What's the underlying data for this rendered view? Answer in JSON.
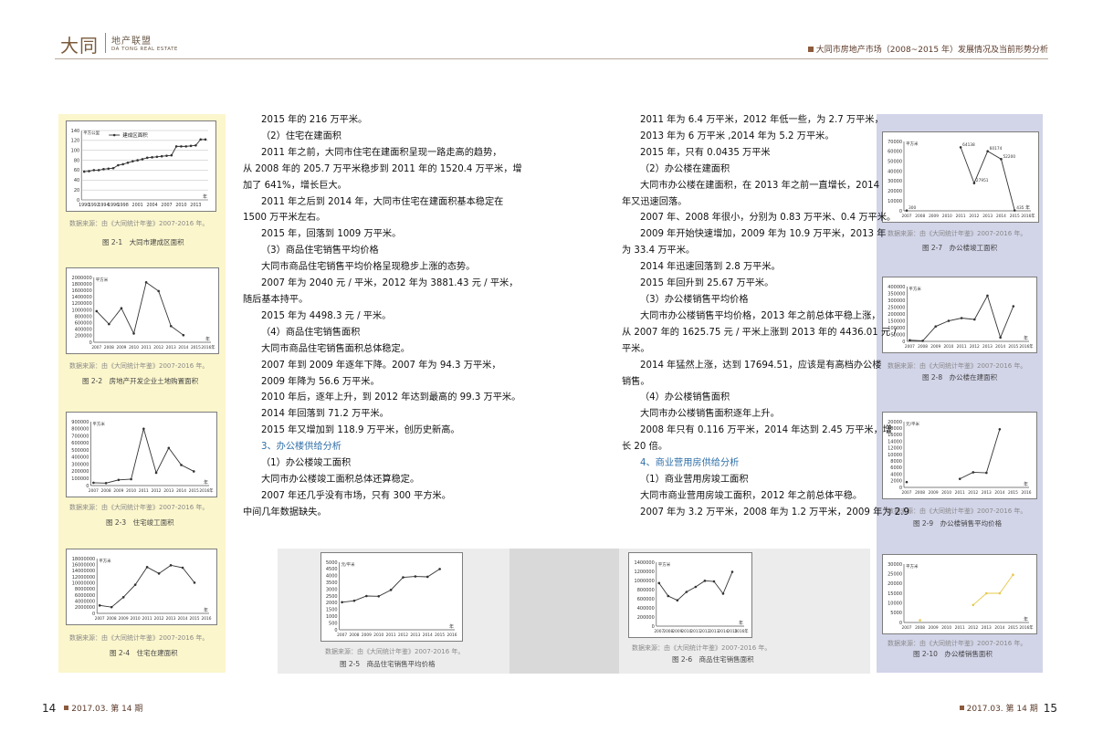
{
  "header": {
    "logo_mark": "大同",
    "logo_cn": "地产联盟",
    "logo_en": "DA TONG REAL ESTATE",
    "title": "大同市房地产市场（2008~2015 年）发展情况及当前形势分析"
  },
  "left_page": {
    "column1": [
      "2015 年的 216 万平米。",
      "（2）住宅在建面积",
      "2011 年之前，大同市住宅在建面积呈现一路走高的趋势，",
      "从 2008 年的 205.7 万平米稳步到 2011 年的 1520.4 万平米，增",
      "加了 641%，增长巨大。",
      "2011 年之后到 2014 年，大同市住宅在建面积基本稳定在",
      "1500 万平米左右。",
      "2015 年，回落到 1009 万平米。",
      "（3）商品住宅销售平均价格",
      "大同市商品住宅销售平均价格呈现稳步上涨的态势。",
      "2007 年为 2040 元 / 平米，2012 年为 3881.43 元 / 平米，",
      "随后基本持平。",
      "2015 年为 4498.3 元 / 平米。",
      "（4）商品住宅销售面积",
      "大同市商品住宅销售面积总体稳定。",
      "2007 年到 2009 年逐年下降。2007 年为 94.3 万平米，",
      "2009 年降为 56.6 万平米。",
      "2010 年后，逐年上升，到 2012 年达到最高的 99.3 万平米。",
      "2014 年回落到 71.2 万平米。",
      "2015 年又增加到 118.9 万平米，创历史新高。",
      "3、办公楼供给分析",
      "（1）办公楼竣工面积",
      "大同市办公楼竣工面积总体还算稳定。",
      "2007 年还几乎没有市场，只有 300 平方米。",
      "中间几年数据缺失。"
    ],
    "footer_page": "14",
    "footer_issue": "2017.03. 第 14 期"
  },
  "right_page": {
    "column2": [
      "2011 年为 6.4 万平米，2012 年低一些，为 2.7 万平米，",
      "2013 年为 6 万平米 ,2014 年为 5.2 万平米。",
      "2015 年，只有 0.0435 万平米",
      "（2）办公楼在建面积",
      "大同市办公楼在建面积，在 2013 年之前一直增长，2014",
      "年又迅速回落。",
      "2007 年、2008 年很小，分别为 0.83 万平米、0.4 万平米。",
      "2009 年开始快速增加，2009 年为 10.9 万平米，2013 年",
      "为 33.4 万平米。",
      "2014 年迅速回落到 2.8 万平米。",
      "2015 年回升到 25.67 万平米。",
      "（3）办公楼销售平均价格",
      "大同市办公楼销售平均价格，2013 年之前总体平稳上涨，",
      "从 2007 年的 1625.75 元 / 平米上涨到 2013 年的 4436.01 元 /",
      "平米。",
      "2014 年猛然上涨，达到 17694.51，应该是有高档办公楼",
      "销售。",
      "（4）办公楼销售面积",
      "大同市办公楼销售面积逐年上升。",
      "2008 年只有 0.116 万平米，2014 年达到 2.45 万平米，增",
      "长 20 倍。",
      "4、商业营用房供给分析",
      "（1）商业营用房竣工面积",
      "大同市商业营用房竣工面积，2012 年之前总体平稳。",
      "2007 年为 3.2 万平米，2008 年为 1.2 万平米，2009 年为 2.9"
    ],
    "footer_page": "15",
    "footer_issue": "2017.03. 第 14 期"
  },
  "figures": {
    "source_text": "数据来源：由《大同统计年鉴》2007-2016 年。",
    "fig1": {
      "caption": "图 2-1　大同市建成区面积",
      "legend": "建成区面积"
    },
    "fig2": {
      "caption": "图 2-2　房地产开发企业土地购置面积"
    },
    "fig3": {
      "caption": "图 2-3　住宅竣工面积"
    },
    "fig4": {
      "caption": "图 2-4　住宅在建面积"
    },
    "fig5": {
      "caption": "图 2-5　商品住宅销售平均价格"
    },
    "fig6": {
      "caption": "图 2-6　商品住宅销售面积"
    },
    "fig7": {
      "caption": "图 2-7　办公楼竣工面积"
    },
    "fig8": {
      "caption": "图 2-8　办公楼在建面积"
    },
    "fig9": {
      "caption": "图 2-9　办公楼销售平均价格"
    },
    "fig10": {
      "caption": "图 2-10　办公楼销售面积"
    }
  },
  "chart_data": [
    {
      "id": "fig1",
      "type": "line",
      "title": "",
      "legend": [
        "建成区面积"
      ],
      "ylabel": "平方公里",
      "xlabel": "年",
      "x": [
        1990,
        1991,
        1992,
        1993,
        1994,
        1995,
        1996,
        1997,
        1998,
        1999,
        2000,
        2001,
        2002,
        2003,
        2004,
        2005,
        2006,
        2007,
        2008,
        2009,
        2010,
        2011,
        2012,
        2013,
        2014,
        2015
      ],
      "values": [
        57,
        58,
        60,
        60,
        62,
        63,
        64,
        70,
        72,
        75,
        78,
        80,
        82,
        85,
        86,
        87,
        88,
        89,
        90,
        108,
        108,
        108,
        109,
        110,
        122,
        122
      ],
      "ylim": [
        0,
        140
      ],
      "yticks": [
        0,
        20,
        40,
        60,
        80,
        100,
        120,
        140
      ],
      "xticks": [
        "1990",
        "1992",
        "1994",
        "1996",
        "1998",
        "2001",
        "2004",
        "2007",
        "2010",
        "2013"
      ],
      "color": "#333333",
      "grid": true
    },
    {
      "id": "fig2",
      "type": "line",
      "ylabel": "平方米",
      "xlabel": "年",
      "categories": [
        "2007",
        "2008",
        "2009",
        "2010",
        "2011",
        "2012",
        "2013",
        "2014",
        "2015",
        "2016年"
      ],
      "values": [
        960000,
        560000,
        1050000,
        270000,
        1850000,
        1580000,
        500000,
        220000
      ],
      "ylim": [
        0,
        2000000
      ],
      "yticks": [
        0,
        200000,
        400000,
        600000,
        800000,
        1000000,
        1200000,
        1400000,
        1600000,
        1800000,
        2000000
      ],
      "color": "#333333",
      "grid": false
    },
    {
      "id": "fig3",
      "type": "line",
      "ylabel": "平方米",
      "xlabel": "年",
      "categories": [
        "2007",
        "2008",
        "2009",
        "2010",
        "2011",
        "2012",
        "2013",
        "2014",
        "2015",
        "2016年"
      ],
      "values": [
        40000,
        35000,
        80000,
        90000,
        800000,
        180000,
        530000,
        290000,
        200000
      ],
      "ylim": [
        0,
        900000
      ],
      "yticks": [
        0,
        100000,
        200000,
        300000,
        400000,
        500000,
        600000,
        700000,
        800000,
        900000
      ],
      "color": "#333333",
      "grid": false
    },
    {
      "id": "fig4",
      "type": "line",
      "ylabel": "平方米",
      "xlabel": "年",
      "categories": [
        "2007",
        "2008",
        "2009",
        "2010",
        "2011",
        "2012",
        "2013",
        "2014",
        "2015",
        "2016"
      ],
      "values": [
        2600000,
        2050000,
        5300000,
        9400000,
        15200000,
        13100000,
        15800000,
        15000000,
        10090000
      ],
      "ylim": [
        0,
        18000000
      ],
      "yticks": [
        0,
        2000000,
        4000000,
        6000000,
        8000000,
        10000000,
        12000000,
        14000000,
        16000000,
        18000000
      ],
      "color": "#333333",
      "grid": false
    },
    {
      "id": "fig5",
      "type": "line",
      "ylabel": "元/平米",
      "xlabel": "年",
      "categories": [
        "2007",
        "2008",
        "2009",
        "2010",
        "2011",
        "2012",
        "2013",
        "2014",
        "2015",
        "2016"
      ],
      "values": [
        2040,
        2150,
        2500,
        2480,
        2950,
        3881.43,
        3950,
        3920,
        4498.3
      ],
      "ylim": [
        0,
        5000
      ],
      "yticks": [
        0,
        500,
        1000,
        1500,
        2000,
        2500,
        3000,
        3500,
        4000,
        4500,
        5000
      ],
      "color": "#333333",
      "grid": false
    },
    {
      "id": "fig6",
      "type": "line",
      "ylabel": "平方米",
      "xlabel": "年",
      "categories": [
        "2007",
        "2008",
        "2009",
        "2010",
        "2011",
        "2012",
        "2013",
        "2014",
        "2015",
        "2016年"
      ],
      "values": [
        943000,
        660000,
        566000,
        750000,
        860000,
        993000,
        980000,
        712000,
        1189000
      ],
      "ylim": [
        0,
        1400000
      ],
      "yticks": [
        0,
        200000,
        400000,
        600000,
        800000,
        1000000,
        1200000,
        1400000
      ],
      "color": "#333333",
      "grid": false
    },
    {
      "id": "fig7",
      "type": "line",
      "ylabel": "平方米",
      "xlabel": "年",
      "categories": [
        "2007",
        "2008",
        "2009",
        "2010",
        "2011",
        "2012",
        "2013",
        "2014",
        "2015",
        "2016年"
      ],
      "values": [
        300,
        null,
        null,
        null,
        64138,
        27951,
        60174,
        52200,
        435
      ],
      "point_labels": [
        "300",
        "",
        "",
        "",
        "64138",
        "27951",
        "60174",
        "52200",
        "435"
      ],
      "ylim": [
        0,
        70000
      ],
      "yticks": [
        0,
        10000,
        20000,
        30000,
        40000,
        50000,
        60000,
        70000
      ],
      "color": "#333333",
      "grid": false
    },
    {
      "id": "fig8",
      "type": "line",
      "ylabel": "平方米",
      "xlabel": "年",
      "categories": [
        "2007",
        "2008",
        "2009",
        "2010",
        "2011",
        "2012",
        "2013",
        "2014",
        "2015",
        "2016年"
      ],
      "values": [
        8300,
        4000,
        109000,
        150000,
        170000,
        160000,
        334000,
        28000,
        256700
      ],
      "ylim": [
        0,
        400000
      ],
      "yticks": [
        0,
        50000,
        100000,
        150000,
        200000,
        250000,
        300000,
        350000,
        400000
      ],
      "color": "#333333",
      "grid": false
    },
    {
      "id": "fig9",
      "type": "line",
      "ylabel": "元/平米",
      "xlabel": "年",
      "categories": [
        "2007",
        "2008",
        "2009",
        "2010",
        "2011",
        "2012",
        "2013",
        "2014",
        "2015",
        "2016"
      ],
      "values": [
        1625.75,
        null,
        null,
        null,
        2600,
        4600,
        4436.01,
        17694.51
      ],
      "ylim": [
        0,
        20000
      ],
      "yticks": [
        0,
        2000,
        4000,
        6000,
        8000,
        10000,
        12000,
        14000,
        16000,
        18000,
        20000
      ],
      "color": "#333333",
      "grid": false
    },
    {
      "id": "fig10",
      "type": "line",
      "ylabel": "平方米",
      "xlabel": "年",
      "categories": [
        "2007",
        "2008",
        "2009",
        "2010",
        "2011",
        "2012",
        "2013",
        "2014",
        "2015",
        "2016年"
      ],
      "values": [
        null,
        1160,
        null,
        null,
        null,
        9000,
        15000,
        15000,
        24500
      ],
      "ylim": [
        0,
        30000
      ],
      "yticks": [
        0,
        5000,
        10000,
        15000,
        20000,
        25000,
        30000
      ],
      "color": "#e6c84a",
      "grid": false
    }
  ]
}
